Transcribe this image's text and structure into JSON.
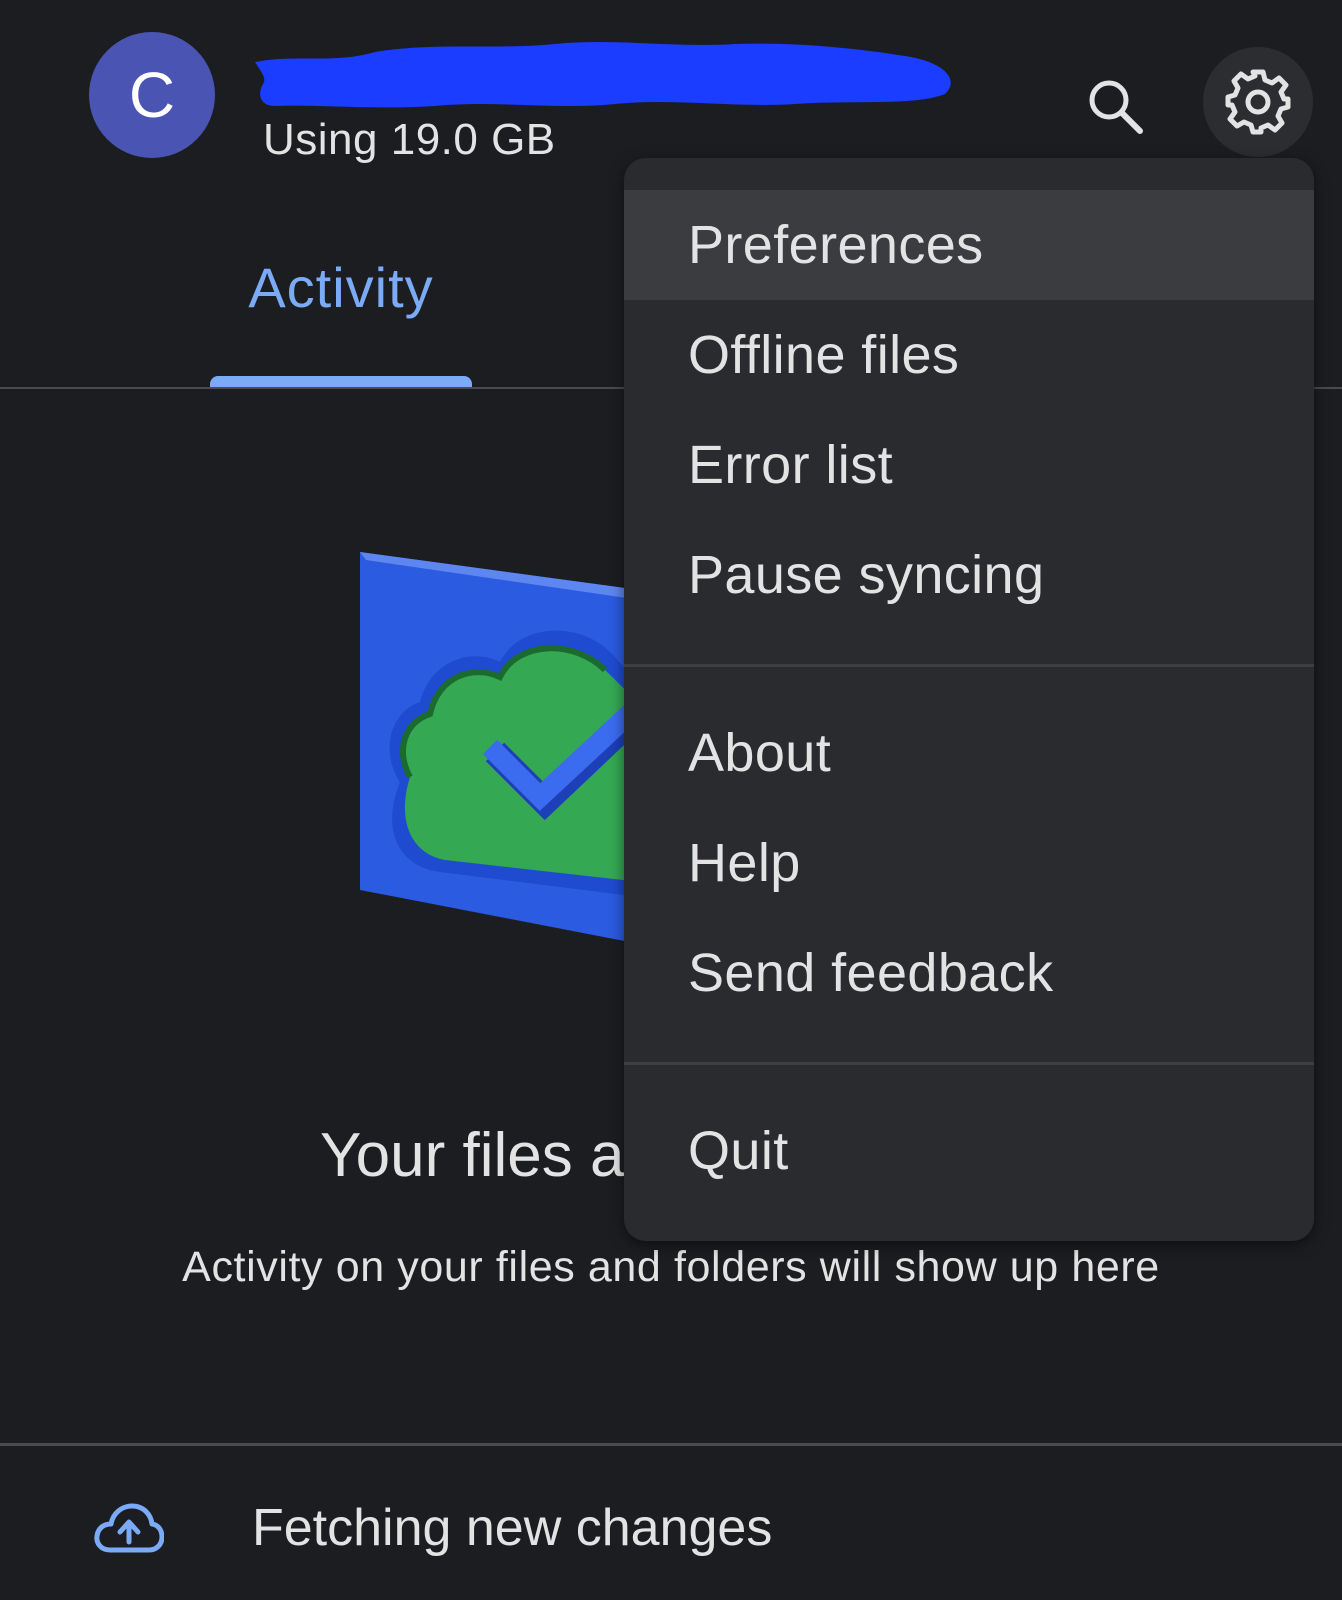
{
  "header": {
    "avatar_letter": "C",
    "account_name": "",
    "storage_text": "Using 19.0 GB"
  },
  "tabs": {
    "active_label": "Activity"
  },
  "empty_state": {
    "title": "Your files a",
    "subtitle": "Activity on your files and folders will show up here"
  },
  "status": {
    "text": "Fetching new changes"
  },
  "menu": {
    "items": [
      {
        "label": "Preferences"
      },
      {
        "label": "Offline files"
      },
      {
        "label": "Error list"
      },
      {
        "label": "Pause syncing"
      },
      {
        "label": "About"
      },
      {
        "label": "Help"
      },
      {
        "label": "Send feedback"
      },
      {
        "label": "Quit"
      }
    ]
  },
  "colors": {
    "background": "#1c1d20",
    "menu_background": "#2a2b2e",
    "menu_highlight": "#3b3c40",
    "accent": "#7baaf7",
    "avatar": "#4a55b3",
    "redaction": "#1a3dff",
    "illustration_blue": "#2a5be0",
    "illustration_green": "#34a853"
  },
  "icons": {
    "search": "search-icon",
    "settings": "gear-icon",
    "status": "cloud-upload-icon"
  }
}
